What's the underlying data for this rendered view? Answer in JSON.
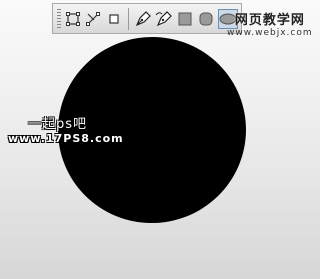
{
  "toolbar": {
    "tools": [
      {
        "icon": "path-select-icon"
      },
      {
        "icon": "direct-select-icon"
      },
      {
        "icon": "small-square-icon"
      },
      {
        "icon": "pen-icon"
      },
      {
        "icon": "freeform-pen-icon"
      },
      {
        "icon": "rectangle-icon"
      },
      {
        "icon": "rounded-rectangle-icon"
      },
      {
        "icon": "ellipse-icon",
        "active": true
      }
    ]
  },
  "canvas": {
    "shape": "ellipse",
    "fill": "#000000"
  },
  "watermark_top": {
    "line1": "网页教学网",
    "line2": "www.webjx.com"
  },
  "watermark_left": {
    "line1": "一起ps吧",
    "line2": "www.17PS8.com"
  }
}
